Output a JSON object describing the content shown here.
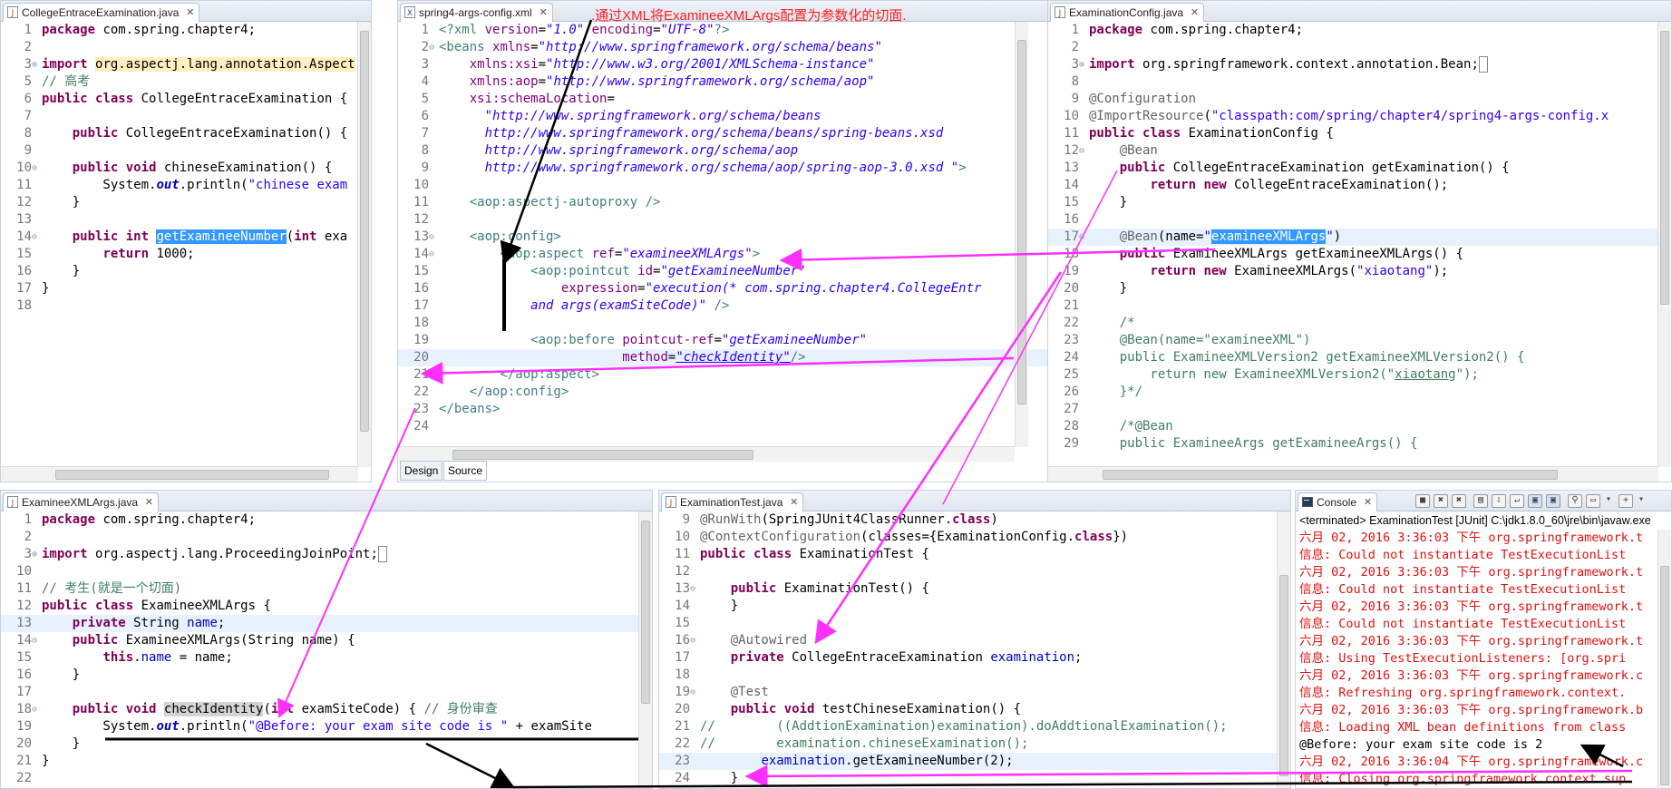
{
  "caption": ".通过XML将ExamineeXMLArgs配置为参数化的切面.",
  "panes": {
    "college": {
      "tab_title": "CollegeEntraceExamination.java",
      "lines": [
        {
          "n": "1",
          "html": "<span class=\"kw\">package</span> com.spring.chapter4;"
        },
        {
          "n": "2",
          "html": ""
        },
        {
          "n": "3",
          "fold": "⊕",
          "html": "<span class=\"kw\">import</span> <span style=\"background:#fff0c0\">org.aspectj.lang.annotation.Aspect</span>"
        },
        {
          "n": "5",
          "html": "<span class=\"cmt\">// 高考</span>"
        },
        {
          "n": "6",
          "html": "<span class=\"kw\">public</span> <span class=\"kw\">class</span> CollegeEntraceExamination {"
        },
        {
          "n": "7",
          "html": ""
        },
        {
          "n": "8",
          "html": "    <span class=\"kw\">public</span> CollegeEntraceExamination() {"
        },
        {
          "n": "9",
          "html": ""
        },
        {
          "n": "10",
          "fold": "⊖",
          "html": "    <span class=\"kw\">public</span> <span class=\"kw\">void</span> chineseExamination() {"
        },
        {
          "n": "11",
          "html": "        System.<span class=\"sfld\">out</span>.println(<span class=\"str\">\"chinese exam</span>"
        },
        {
          "n": "12",
          "html": "    }"
        },
        {
          "n": "13",
          "html": ""
        },
        {
          "n": "14",
          "fold": "⊖",
          "html": "    <span class=\"kw\">public</span> <span class=\"kw\">int</span> <span class=\"sel\">getExamineeNumber</span>(<span class=\"kw\">int</span> exa"
        },
        {
          "n": "15",
          "html": "        <span class=\"kw\">return</span> 1000;"
        },
        {
          "n": "16",
          "html": "    }"
        },
        {
          "n": "17",
          "html": "}"
        },
        {
          "n": "18",
          "html": ""
        }
      ]
    },
    "xml": {
      "tab_title": "spring4-args-config.xml",
      "design_tab": "Design",
      "source_tab": "Source",
      "lines": [
        {
          "n": "1",
          "html": "<span class=\"tag\">&lt;?xml</span> <span class=\"attr\">version</span>=<span class=\"xstr\">\"1.0\"</span> <span class=\"attr\">encoding</span>=<span class=\"xstr\">\"UTF-8\"</span><span class=\"tag\">?&gt;</span>"
        },
        {
          "n": "2",
          "fold": "⊖",
          "html": "<span class=\"tag\">&lt;beans</span> <span class=\"attr\">xmlns</span>=<span class=\"xstr\">\"http://www.springframework.org/schema/beans\"</span>"
        },
        {
          "n": "3",
          "html": "    <span class=\"attr\">xmlns:xsi</span>=<span class=\"xstr\">\"http://www.w3.org/2001/XMLSchema-instance\"</span>"
        },
        {
          "n": "4",
          "html": "    <span class=\"attr\">xmlns:aop</span>=<span class=\"xstr\">\"http://www.springframework.org/schema/aop\"</span>"
        },
        {
          "n": "5",
          "html": "    <span class=\"attr\">xsi:schemaLocation</span>="
        },
        {
          "n": "6",
          "html": "      <span class=\"xstr\">\"http://www.springframework.org/schema/beans</span>"
        },
        {
          "n": "7",
          "html": "      <span class=\"xstr\">http://www.springframework.org/schema/beans/spring-beans.xsd</span>"
        },
        {
          "n": "8",
          "html": "      <span class=\"xstr\">http://www.springframework.org/schema/aop</span>"
        },
        {
          "n": "9",
          "html": "      <span class=\"xstr\">http://www.springframework.org/schema/aop/spring-aop-3.0.xsd \"</span><span class=\"tag\">&gt;</span>"
        },
        {
          "n": "10",
          "html": ""
        },
        {
          "n": "11",
          "html": "    <span class=\"tag\">&lt;aop:aspectj-autoproxy /&gt;</span>"
        },
        {
          "n": "12",
          "html": ""
        },
        {
          "n": "13",
          "fold": "⊖",
          "html": "    <span class=\"tag\">&lt;aop:config&gt;</span>"
        },
        {
          "n": "14",
          "fold": "⊖",
          "html": "        <span class=\"tag\">&lt;aop:aspect</span> <span class=\"attr\">ref</span>=<span class=\"xstr\">\"examineeXMLArgs\"</span><span class=\"tag\">&gt;</span>"
        },
        {
          "n": "15",
          "html": "            <span class=\"tag\">&lt;aop:pointcut</span> <span class=\"attr\">id</span>=<span class=\"xstr\">\"getExamineeNumber\"</span>"
        },
        {
          "n": "16",
          "html": "                <span class=\"attr\">expression</span>=<span class=\"xstr\">\"execution(* com.spring.chapter4.CollegeEntr</span>"
        },
        {
          "n": "17",
          "html": "            <span class=\"xstr\">and args(examSiteCode)\"</span> <span class=\"tag\">/&gt;</span>"
        },
        {
          "n": "18",
          "html": ""
        },
        {
          "n": "19",
          "html": "            <span class=\"tag\">&lt;aop:before</span> <span class=\"attr\">pointcut-ref</span>=<span class=\"xstr\">\"getExamineeNumber\"</span>"
        },
        {
          "n": "20",
          "hl": true,
          "html": "                        <span class=\"attr\">method</span>=<span class=\"xstr\" style=\"text-decoration:underline\">\"checkIdentity\"</span><span class=\"tag\">/&gt;</span>"
        },
        {
          "n": "21",
          "html": "        <span class=\"tag\">&lt;/aop:aspect&gt;</span>"
        },
        {
          "n": "22",
          "html": "    <span class=\"tag\">&lt;/aop:config&gt;</span>"
        },
        {
          "n": "23",
          "html": "<span class=\"tag\">&lt;/beans&gt;</span>"
        },
        {
          "n": "24",
          "html": ""
        }
      ]
    },
    "config": {
      "tab_title": "ExaminationConfig.java",
      "lines": [
        {
          "n": "1",
          "html": "<span class=\"kw\">package</span> com.spring.chapter4;"
        },
        {
          "n": "2",
          "html": ""
        },
        {
          "n": "3",
          "fold": "⊕",
          "html": "<span class=\"kw\">import</span> org.springframework.context.annotation.Bean;<span style=\"border:1px solid #888\"> </span>"
        },
        {
          "n": "8",
          "html": ""
        },
        {
          "n": "9",
          "html": "<span class=\"ann\">@Configuration</span>"
        },
        {
          "n": "10",
          "html": "<span class=\"ann\">@ImportResource</span>(<span class=\"str\">\"classpath:com/spring/chapter4/spring4-args-config.x</span>"
        },
        {
          "n": "11",
          "html": "<span class=\"kw\">public</span> <span class=\"kw\">class</span> ExaminationConfig {"
        },
        {
          "n": "12",
          "fold": "⊖",
          "html": "    <span class=\"ann\">@Bean</span>"
        },
        {
          "n": "13",
          "html": "    <span class=\"kw\">public</span> CollegeEntraceExamination getExamination() {"
        },
        {
          "n": "14",
          "html": "        <span class=\"kw\">return</span> <span class=\"kw\">new</span> CollegeEntraceExamination();"
        },
        {
          "n": "15",
          "html": "    }"
        },
        {
          "n": "16",
          "html": ""
        },
        {
          "n": "17",
          "fold": "⊖",
          "hl": true,
          "html": "    <span class=\"ann\">@Bean</span>(name=<span class=\"str\">\"</span><span class=\"sel\">examineeXMLArgs</span><span class=\"str\">\"</span>)"
        },
        {
          "n": "18",
          "html": "    <span class=\"kw\">public</span> ExamineeXMLArgs getExamineeXMLArgs() {"
        },
        {
          "n": "19",
          "html": "        <span class=\"kw\">return</span> <span class=\"kw\">new</span> ExamineeXMLArgs(<span class=\"str\">\"xiaotang\"</span>);"
        },
        {
          "n": "20",
          "html": "    }"
        },
        {
          "n": "21",
          "html": ""
        },
        {
          "n": "22",
          "html": "    <span class=\"cmt\">/*</span>"
        },
        {
          "n": "23",
          "html": "    <span class=\"cmt\">@Bean(name=\"examineeXML\")</span>"
        },
        {
          "n": "24",
          "html": "    <span class=\"cmt\">public ExamineeXMLVersion2 getExamineeXMLVersion2() {</span>"
        },
        {
          "n": "25",
          "html": "    <span class=\"cmt\">    return new ExamineeXMLVersion2(\"<u>xiaotang</u>\");</span>"
        },
        {
          "n": "26",
          "html": "    <span class=\"cmt\">}*/</span>"
        },
        {
          "n": "27",
          "html": ""
        },
        {
          "n": "28",
          "html": "    <span class=\"cmt\">/*@Bean</span>"
        },
        {
          "n": "29",
          "html": "    <span class=\"cmt\">public ExamineeArgs getExamineeArgs() {</span>"
        }
      ]
    },
    "examinee": {
      "tab_title": "ExamineeXMLArgs.java",
      "lines": [
        {
          "n": "1",
          "html": "<span class=\"kw\">package</span> com.spring.chapter4;"
        },
        {
          "n": "2",
          "html": ""
        },
        {
          "n": "3",
          "fold": "⊕",
          "html": "<span class=\"kw\">import</span> org.aspectj.lang.ProceedingJoinPoint;<span style=\"border:1px solid #888\"> </span>"
        },
        {
          "n": "10",
          "html": ""
        },
        {
          "n": "11",
          "html": "<span class=\"cmt\">// 考生(就是一个切面)</span>"
        },
        {
          "n": "12",
          "html": "<span class=\"kw\">public</span> <span class=\"kw\">class</span> ExamineeXMLArgs {"
        },
        {
          "n": "13",
          "hl": true,
          "html": "    <span class=\"kw\">private</span> String <span class=\"fld\">name</span>;"
        },
        {
          "n": "14",
          "fold": "⊖",
          "html": "    <span class=\"kw\">public</span> ExamineeXMLArgs(String name) {"
        },
        {
          "n": "15",
          "html": "        <span class=\"kw\">this</span>.<span class=\"fld\">name</span> = name;"
        },
        {
          "n": "16",
          "html": "    }"
        },
        {
          "n": "17",
          "html": ""
        },
        {
          "n": "18",
          "fold": "⊖",
          "html": "    <span class=\"kw\">public</span> <span class=\"kw\">void</span> <span class=\"mark\">checkIdentity</span>(<span class=\"kw\">int</span> examSiteCode) { <span class=\"cmt\">// 身份审查</span>"
        },
        {
          "n": "19",
          "html": "        System.<span class=\"sfld\">out</span>.println(<span class=\"str\">\"@Before: your exam site code is \"</span> + examSite"
        },
        {
          "n": "20",
          "html": "    }"
        },
        {
          "n": "21",
          "html": "}"
        },
        {
          "n": "22",
          "html": ""
        }
      ]
    },
    "test": {
      "tab_title": "ExaminationTest.java",
      "lines": [
        {
          "n": "9",
          "html": "<span class=\"ann\">@RunWith</span>(SpringJUnit4ClassRunner.<span class=\"kw\">class</span>)"
        },
        {
          "n": "10",
          "html": "<span class=\"ann\">@ContextConfiguration</span>(classes={ExaminationConfig.<span class=\"kw\">class</span>})"
        },
        {
          "n": "11",
          "html": "<span class=\"kw\">public</span> <span class=\"kw\">class</span> ExaminationTest {"
        },
        {
          "n": "12",
          "html": ""
        },
        {
          "n": "13",
          "fold": "⊖",
          "html": "    <span class=\"kw\">public</span> ExaminationTest() {"
        },
        {
          "n": "14",
          "html": "    }"
        },
        {
          "n": "15",
          "html": ""
        },
        {
          "n": "16",
          "fold": "⊖",
          "html": "    <span class=\"ann\">@Autowired</span>"
        },
        {
          "n": "17",
          "html": "    <span class=\"kw\">private</span> CollegeEntraceExamination <span class=\"fld\">examination</span>;"
        },
        {
          "n": "18",
          "html": ""
        },
        {
          "n": "19",
          "fold": "⊖",
          "html": "    <span class=\"ann\">@Test</span>"
        },
        {
          "n": "20",
          "html": "    <span class=\"kw\">public</span> <span class=\"kw\">void</span> testChineseExamination() {"
        },
        {
          "n": "21",
          "html": "<span class=\"cmt\">//        ((AddtionExamination)examination).doAddtionalExamination();</span>"
        },
        {
          "n": "22",
          "html": "<span class=\"cmt\">//        examination.chineseExamination();</span>"
        },
        {
          "n": "23",
          "hl": true,
          "html": "        <span class=\"fld\">examination</span>.getExamineeNumber(2);"
        },
        {
          "n": "24",
          "html": "    }"
        }
      ]
    },
    "console": {
      "tab_title": "Console",
      "status": "<terminated> ExaminationTest [JUnit] C:\\jdk1.8.0_60\\jre\\bin\\javaw.exe",
      "lines": [
        {
          "html": "<span class=\"err\">六月 02, 2016 3:36:03 下午 org.springframework.t</span>"
        },
        {
          "html": "<span class=\"err\">信息: Could not instantiate TestExecutionList</span>"
        },
        {
          "html": "<span class=\"err\">六月 02, 2016 3:36:03 下午 org.springframework.t</span>"
        },
        {
          "html": "<span class=\"err\">信息: Could not instantiate TestExecutionList</span>"
        },
        {
          "html": "<span class=\"err\">六月 02, 2016 3:36:03 下午 org.springframework.t</span>"
        },
        {
          "html": "<span class=\"err\">信息: Could not instantiate TestExecutionList</span>"
        },
        {
          "html": "<span class=\"err\">六月 02, 2016 3:36:03 下午 org.springframework.t</span>"
        },
        {
          "html": "<span class=\"err\">信息: Using TestExecutionListeners: [org.spri</span>"
        },
        {
          "html": "<span class=\"err\">六月 02, 2016 3:36:03 下午 org.springframework.c</span>"
        },
        {
          "html": "<span class=\"err\">信息: Refreshing org.springframework.context.</span>"
        },
        {
          "html": "<span class=\"err\">六月 02, 2016 3:36:03 下午 org.springframework.b</span>"
        },
        {
          "html": "<span class=\"err\">信息: Loading XML bean definitions from class</span>"
        },
        {
          "html": "@Before: your exam site code is 2"
        },
        {
          "html": "<span class=\"err\">六月 02, 2016 3:36:04 下午 org.springframework.c</span>"
        },
        {
          "html": "<span class=\"err\">信息: Closing org.springframework.context.sup</span>"
        }
      ]
    }
  },
  "colors": {
    "arrow_magenta": "#ff30ff",
    "arrow_black": "#000000",
    "caption_red": "#ff2020"
  }
}
